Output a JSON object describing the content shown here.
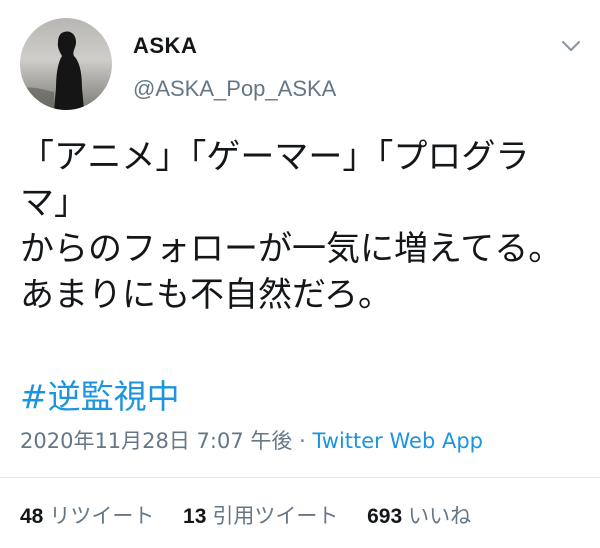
{
  "author": {
    "display_name": "ASKA",
    "handle": "@ASKA_Pop_ASKA",
    "avatar_icon": "profile-photo-silhouette"
  },
  "menu": {
    "icon": "chevron-down-icon"
  },
  "tweet": {
    "lines": [
      "「アニメ」「ゲーマー」「プログラ",
      "マ」",
      "からのフォローが一気に増えてる。",
      "あまりにも不自然だろ。"
    ],
    "hashtag": "#逆監視中"
  },
  "meta": {
    "timestamp": "2020年11月28日 7:07 午後",
    "separator": " · ",
    "source": "Twitter Web App"
  },
  "stats": {
    "retweets_count": "48",
    "retweets_label": "リツイート",
    "quotes_count": "13",
    "quotes_label": "引用ツイート",
    "likes_count": "693",
    "likes_label": "いいね"
  },
  "colors": {
    "link": "#1b95e0",
    "secondary_text": "#657786",
    "primary_text": "#14171a",
    "divider": "#e1e8ed"
  }
}
